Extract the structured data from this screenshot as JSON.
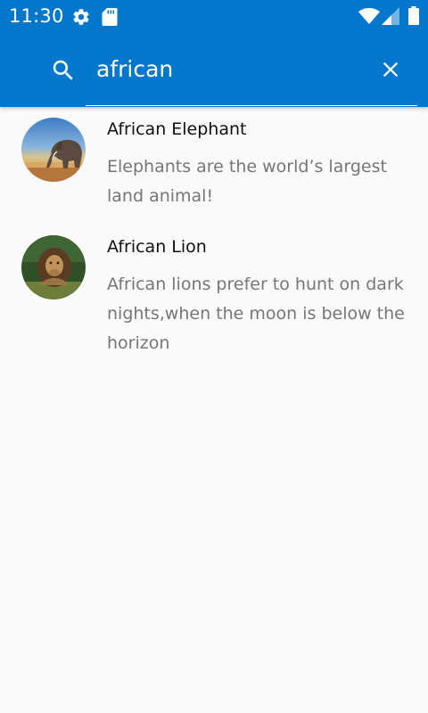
{
  "status_bar": {
    "time": "11:30",
    "icons": [
      "gear-icon",
      "sd-card-icon",
      "wifi-icon",
      "signal-icon",
      "battery-icon"
    ]
  },
  "search": {
    "query": "african",
    "icon": "search-icon",
    "clear_icon": "close-icon"
  },
  "results": [
    {
      "title": "African Elephant",
      "description": "Elephants are the world’s largest land animal!",
      "avatar": "elephant-photo"
    },
    {
      "title": "African Lion",
      "description": "African lions prefer to hunt on dark nights,when the moon is below the horizon",
      "avatar": "lion-photo"
    }
  ],
  "colors": {
    "primary": "#0277cc",
    "background": "#fafafa",
    "title_text": "#111111",
    "secondary_text": "#767676"
  }
}
